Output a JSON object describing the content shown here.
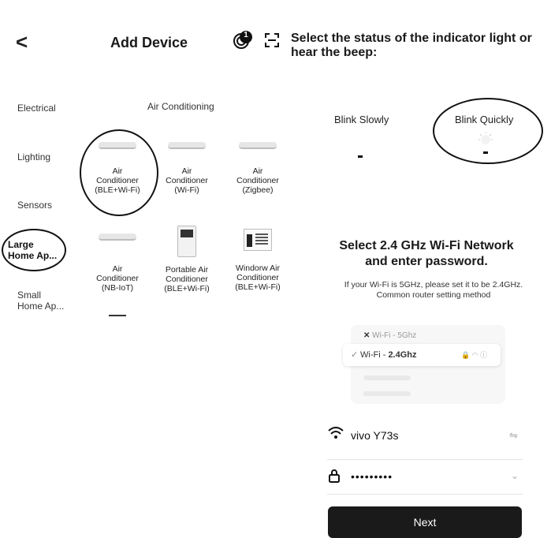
{
  "header": {
    "back_label": "<",
    "title": "Add Device",
    "notification_count": "1"
  },
  "help_text": "Select the status of the indicator light or hear the beep:",
  "categories": [
    {
      "label": "Electrical"
    },
    {
      "label": "Lighting"
    },
    {
      "label": "Sensors"
    },
    {
      "label": "Large\nHome Ap..."
    },
    {
      "label": "Small\nHome Ap..."
    }
  ],
  "section_title": "Air Conditioning",
  "devices": [
    {
      "name": "Air\nConditioner\n(BLE+Wi-Fi)",
      "icon": "air-conditioner-icon"
    },
    {
      "name": "Air\nConditioner\n(Wi-Fi)",
      "icon": "air-conditioner-icon"
    },
    {
      "name": "Air\nConditioner\n(Zigbee)",
      "icon": "air-conditioner-icon"
    },
    {
      "name": "Air\nConditioner\n(NB-IoT)",
      "icon": "air-conditioner-icon"
    },
    {
      "name": "Portable Air\nConditioner\n(BLE+Wi-Fi)",
      "icon": "portable-ac-icon"
    },
    {
      "name": "Windorw Air\nConditioner\n(BLE+Wi-Fi)",
      "icon": "window-ac-icon"
    }
  ],
  "blink": {
    "slow_label": "Blink Slowly",
    "quick_label": "Blink Quickly"
  },
  "wifi_heading": "Select 2.4 GHz Wi-Fi Network\nand enter password.",
  "wifi_note": "If your Wi-Fi is 5GHz, please set it to be 2.4GHz.\nCommon router setting method",
  "wifi_example": {
    "bad_label": "Wi-Fi - 5Ghz",
    "good_prefix": "Wi-Fi - ",
    "good_band": "2.4Ghz"
  },
  "network": {
    "ssid": "vivo Y73s",
    "password_mask": "•••••••••"
  },
  "next_label": "Next"
}
